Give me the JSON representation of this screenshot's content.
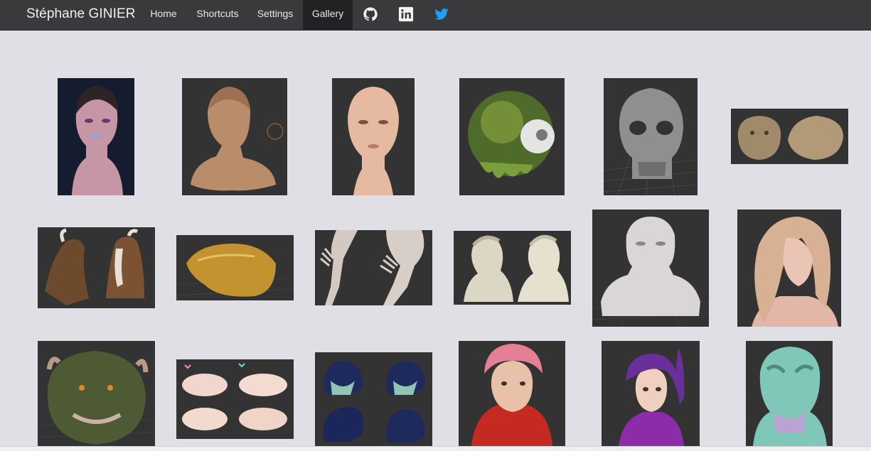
{
  "navbar": {
    "brand": "Stéphane GINIER",
    "items": [
      {
        "label": "Home"
      },
      {
        "label": "Shortcuts"
      },
      {
        "label": "Settings"
      },
      {
        "label": "Gallery",
        "active": true
      }
    ],
    "social": [
      "github-icon",
      "linkedin-icon",
      "twitter-icon"
    ],
    "colors": {
      "bar": "#3a3a3c",
      "active": "#222224",
      "twitter": "#1da1f2"
    }
  },
  "gallery": {
    "items": [
      "sculpt-woman-purple-lips",
      "sculpt-bald-man-bust",
      "sculpt-bald-woman-head",
      "sculpt-green-eye-ball",
      "sculpt-metal-skull",
      "sculpt-tiger-heads",
      "sculpt-horse-heads",
      "sculpt-golden-creature",
      "sculpt-hands-arms",
      "sculpt-man-heads-pair",
      "sculpt-muscular-bust",
      "sculpt-long-hair-woman",
      "sculpt-green-monster",
      "sculpt-pink-blobs",
      "sculpt-blue-creatures",
      "sculpt-pink-hair-boy",
      "sculpt-purple-hair-girl",
      "sculpt-alien-head"
    ]
  }
}
